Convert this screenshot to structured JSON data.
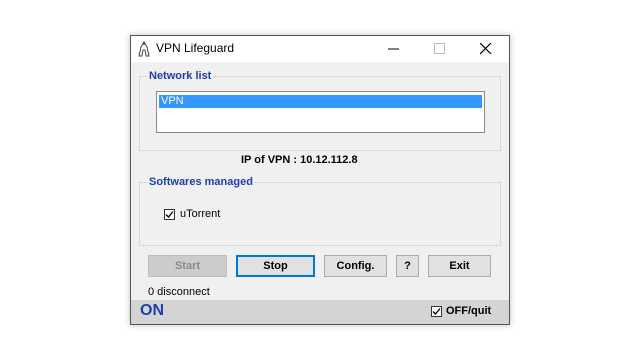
{
  "window": {
    "title": "VPN Lifeguard",
    "icon": "vpn-lifeguard-app-icon"
  },
  "titlebar_buttons": [
    "minimize-icon",
    "maximize-icon",
    "close-icon"
  ],
  "network_group": {
    "label": "Network list",
    "items": [
      {
        "label": "VPN",
        "selected": true
      }
    ]
  },
  "ip_line": "IP of VPN : 10.12.112.8",
  "software_group": {
    "label": "Softwares managed",
    "items": [
      {
        "label": "uTorrent",
        "checked": true
      }
    ]
  },
  "buttons": {
    "start": "Start",
    "stop": "Stop",
    "config": "Config.",
    "help": "?",
    "exit": "Exit"
  },
  "disconnect_count": "0 disconnect",
  "status": {
    "state": "ON",
    "off_quit_label": "OFF/quit",
    "off_quit_checked": true
  },
  "colors": {
    "accent": "#1f3fae",
    "selection": "#3399ff",
    "focus": "#0078d7"
  }
}
